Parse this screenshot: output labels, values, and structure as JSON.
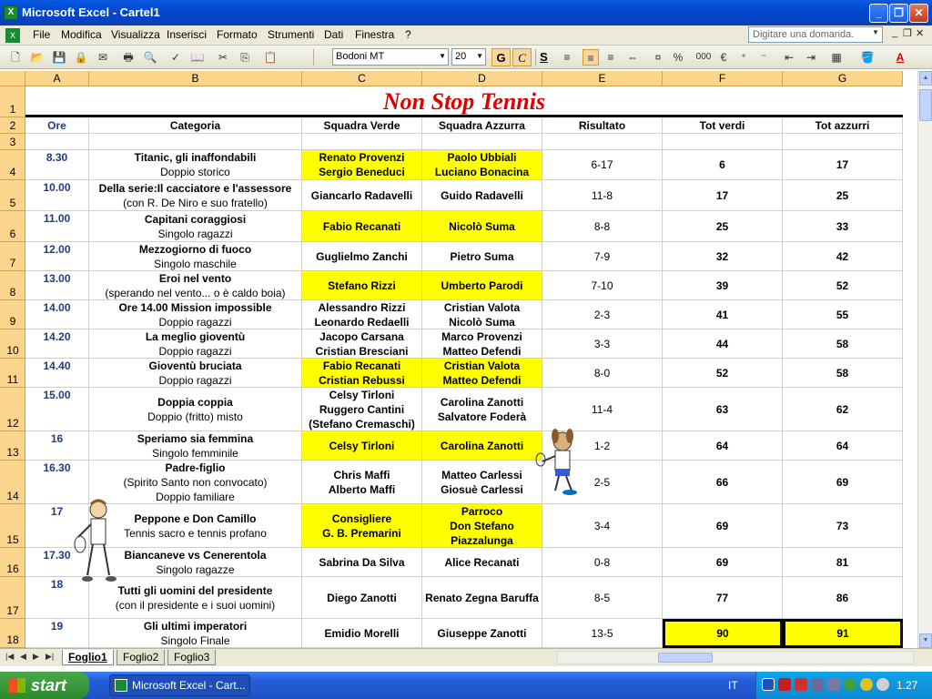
{
  "window": {
    "title": "Microsoft Excel - Cartel1"
  },
  "menu": {
    "items": [
      "File",
      "Modifica",
      "Visualizza",
      "Inserisci",
      "Formato",
      "Strumenti",
      "Dati",
      "Finestra",
      "?"
    ]
  },
  "ask_placeholder": "Digitare una domanda.",
  "format": {
    "font": "Bodoni MT",
    "size": "20",
    "bold_label": "G",
    "italic_label": "C",
    "underline_label": "S",
    "percent_label": "%",
    "thousands_label": "000",
    "euro_label": "€"
  },
  "columns": [
    "A",
    "B",
    "C",
    "D",
    "E",
    "F",
    "G"
  ],
  "rows": [
    "1",
    "2",
    "3",
    "4",
    "5",
    "6",
    "7",
    "8",
    "9",
    "10",
    "11",
    "12",
    "13",
    "14",
    "15",
    "16",
    "17",
    "18"
  ],
  "sheet_title": "Non Stop Tennis",
  "headers": {
    "a": "Ore",
    "b": "Categoria",
    "c": "Squadra Verde",
    "d": "Squadra Azzurra",
    "e": "Risultato",
    "f": "Tot verdi",
    "g": "Tot azzurri"
  },
  "data": [
    {
      "ore": "8.30",
      "cat1": "Titanic, gli inaffondabili",
      "cat2": "Doppio storico",
      "verde": [
        "Renato Provenzi",
        "Sergio Beneduci"
      ],
      "azzurra": [
        "Paolo Ubbiali",
        "Luciano Bonacina"
      ],
      "ris": "6-17",
      "tv": "6",
      "ta": "17"
    },
    {
      "ore": "10.00",
      "cat1": "Della serie:Il cacciatore e l'assessore",
      "cat2": "(con R. De Niro e suo fratello)",
      "verde": [
        "Giancarlo Radavelli"
      ],
      "azzurra": [
        "Guido Radavelli"
      ],
      "ris": "11-8",
      "tv": "17",
      "ta": "25"
    },
    {
      "ore": "11.00",
      "cat1": "Capitani coraggiosi",
      "cat2": "Singolo ragazzi",
      "verde": [
        "Fabio Recanati"
      ],
      "azzurra": [
        "Nicolò Suma"
      ],
      "ris": "8-8",
      "tv": "25",
      "ta": "33"
    },
    {
      "ore": "12.00",
      "cat1": "Mezzogiorno di fuoco",
      "cat2": "Singolo maschile",
      "verde": [
        "Guglielmo Zanchi"
      ],
      "azzurra": [
        "Pietro Suma"
      ],
      "ris": "7-9",
      "tv": "32",
      "ta": "42"
    },
    {
      "ore": "13.00",
      "cat1": "Eroi nel vento",
      "cat2": "(sperando nel vento... o è caldo boia)",
      "verde": [
        "Stefano Rizzi"
      ],
      "azzurra": [
        "Umberto Parodi"
      ],
      "ris": "7-10",
      "tv": "39",
      "ta": "52"
    },
    {
      "ore": "14.00",
      "cat1": "Ore 14.00 Mission impossible",
      "cat2": "Doppio ragazzi",
      "verde": [
        "Alessandro Rizzi",
        "Leonardo Redaelli"
      ],
      "azzurra": [
        "Cristian Valota",
        "Nicolò Suma"
      ],
      "ris": "2-3",
      "tv": "41",
      "ta": "55"
    },
    {
      "ore": "14.20",
      "cat1": "La meglio gioventù",
      "cat2": "Doppio ragazzi",
      "verde": [
        "Jacopo Carsana",
        "Cristian Bresciani"
      ],
      "azzurra": [
        "Marco Provenzi",
        "Matteo Defendi"
      ],
      "ris": "3-3",
      "tv": "44",
      "ta": "58"
    },
    {
      "ore": "14.40",
      "cat1": "Gioventù bruciata",
      "cat2": "Doppio ragazzi",
      "verde": [
        "Fabio Recanati",
        "Cristian Rebussi"
      ],
      "azzurra": [
        "Cristian Valota",
        "Matteo Defendi"
      ],
      "ris": "8-0",
      "tv": "52",
      "ta": "58"
    },
    {
      "ore": "15.00",
      "cat1": "Doppia coppia",
      "cat2": "Doppio (fritto) misto",
      "verde": [
        "Celsy Tirloni",
        "Ruggero Cantini",
        "(Stefano Cremaschi)"
      ],
      "azzurra": [
        "Carolina Zanotti",
        "Salvatore Foderà"
      ],
      "ris": "11-4",
      "tv": "63",
      "ta": "62"
    },
    {
      "ore": "16",
      "cat1": "Speriamo sia femmina",
      "cat2": "Singolo femminile",
      "verde": [
        "Celsy Tirloni"
      ],
      "azzurra": [
        "Carolina Zanotti"
      ],
      "ris": "1-2",
      "tv": "64",
      "ta": "64"
    },
    {
      "ore": "16.30",
      "cat1": "Padre-figlio",
      "cat2": "(Spirito Santo non convocato)",
      "cat3": "Doppio familiare",
      "verde": [
        "Chris Maffi",
        "Alberto Maffi"
      ],
      "azzurra": [
        "Matteo Carlessi",
        "Giosuè Carlessi"
      ],
      "ris": "2-5",
      "tv": "66",
      "ta": "69"
    },
    {
      "ore": "17",
      "cat1": "Peppone e Don Camillo",
      "cat2": "Tennis sacro e tennis profano",
      "verde": [
        "Consigliere",
        "G. B. Premarini"
      ],
      "azzurra": [
        "Parroco",
        "Don Stefano",
        "Piazzalunga"
      ],
      "ris": "3-4",
      "tv": "69",
      "ta": "73"
    },
    {
      "ore": "17.30",
      "cat1": "Biancaneve vs Cenerentola",
      "cat2": "Singolo ragazze",
      "verde": [
        "Sabrina Da Silva"
      ],
      "azzurra": [
        "Alice Recanati"
      ],
      "ris": "0-8",
      "tv": "69",
      "ta": "81"
    },
    {
      "ore": "18",
      "cat1": "Tutti gli uomini del presidente",
      "cat2": "(con il presidente e i suoi uomini)",
      "verde": [
        "Diego Zanotti"
      ],
      "azzurra": [
        "Renato Zegna Baruffa"
      ],
      "ris": "8-5",
      "tv": "77",
      "ta": "86"
    },
    {
      "ore": "19",
      "cat1": "Gli ultimi imperatori",
      "cat2": "Singolo Finale",
      "verde": [
        "Emidio Morelli"
      ],
      "azzurra": [
        "Giuseppe Zanotti"
      ],
      "ris": "13-5",
      "tv": "90",
      "ta": "91"
    }
  ],
  "sheets": [
    "Foglio1",
    "Foglio2",
    "Foglio3"
  ],
  "taskbar": {
    "start": "start",
    "task": "Microsoft Excel - Cart...",
    "lang": "IT",
    "clock": "1.27"
  },
  "colors": {
    "highlight": "#ffff00",
    "title_red": "#e00000",
    "header_orange": "#fbd58c"
  }
}
